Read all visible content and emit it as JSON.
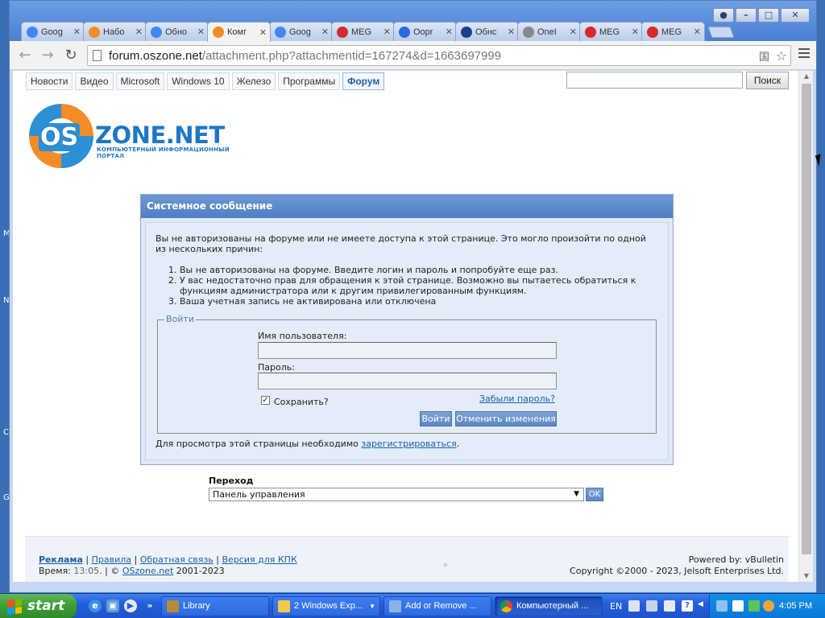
{
  "window": {
    "controls": [
      "user",
      "minimize",
      "maximize",
      "close"
    ]
  },
  "tabs": [
    {
      "label": "Goog",
      "favicon": "chrome-icon",
      "color": "#4285f4"
    },
    {
      "label": "Набо",
      "favicon": "oszone-icon",
      "color": "#f28c28"
    },
    {
      "label": "Обно",
      "favicon": "chrome-icon",
      "color": "#4285f4"
    },
    {
      "label": "Комг",
      "favicon": "oszone-icon",
      "color": "#f28c28",
      "active": true
    },
    {
      "label": "Goog",
      "favicon": "chrome-icon",
      "color": "#4285f4"
    },
    {
      "label": "MEG",
      "favicon": "mega-icon",
      "color": "#d9272e"
    },
    {
      "label": "Oopr",
      "favicon": "arc-icon",
      "color": "#2d6ae0"
    },
    {
      "label": "Обнс",
      "favicon": "ru-icon",
      "color": "#1c3f8a"
    },
    {
      "label": "OneI",
      "favicon": "page-icon",
      "color": "#888888"
    },
    {
      "label": "MEG",
      "favicon": "mega-icon",
      "color": "#d9272e"
    },
    {
      "label": "MEG",
      "favicon": "mega-icon",
      "color": "#d9272e"
    }
  ],
  "address_bar": {
    "host": "forum.oszone.net",
    "path": "/attachment.php?attachmentid=167274&d=1663697999"
  },
  "topnav": {
    "items": [
      "Новости",
      "Видео",
      "Microsoft",
      "Windows 10",
      "Железо",
      "Программы",
      "Форум"
    ],
    "active_index": 6
  },
  "search": {
    "button_label": "Поиск",
    "value": ""
  },
  "logo": {
    "os": "OS",
    "zone": "ZONE.NET",
    "tagline": "КОМПЬЮТЕРНЫЙ ИНФОРМАЦИОННЫЙ ПОРТАЛ"
  },
  "system_message": {
    "title": "Системное сообщение",
    "intro": "Вы не авторизованы на форуме или не имеете доступа к этой странице. Это могло произойти по одной из нескольких причин:",
    "reasons": [
      "Вы не авторизованы на форуме. Введите логин и пароль и попробуйте еще раз.",
      "У вас недостаточно прав для обращения к этой странице. Возможно вы пытаетесь обратиться к функциям администратора или к другим привилегированным функциям.",
      "Ваша учетная запись не активирована или отключена"
    ],
    "login": {
      "legend": "Войти",
      "username_label": "Имя пользователя:",
      "username_value": "",
      "password_label": "Пароль:",
      "password_value": "",
      "remember_label": "Сохранить?",
      "remember_checked": true,
      "forgot_label": "Забыли пароль?",
      "login_button": "Войти",
      "reset_button": "Отменить изменения"
    },
    "register_prefix": "Для просмотра этой страницы необходимо",
    "register_link": "зарегистрироваться",
    "register_suffix": "."
  },
  "jump": {
    "label": "Переход",
    "selected": "Панель управления",
    "ok": "OK"
  },
  "footer": {
    "links": [
      "Реклама",
      "Правила",
      "Обратная связь",
      "Версия для КПК"
    ],
    "time_label": "Время:",
    "time_value": "13:05",
    "copyright_sign": "©",
    "site_link": "OSzone.net",
    "years": "2001-2023",
    "powered": "Powered by: vBulletin",
    "copyright": "Copyright ©2000 - 2023, Jelsoft Enterprises Ltd."
  },
  "taskbar": {
    "start_label": "start",
    "items": [
      {
        "label": "Library",
        "icon": "library-icon",
        "color": "#b58a3a"
      },
      {
        "label": "2 Windows Exp...",
        "icon": "folder-icon",
        "color": "#f2c94c",
        "dropdown": true
      },
      {
        "label": "Add or Remove ...",
        "icon": "programs-icon",
        "color": "#8bb2e8"
      },
      {
        "label": "Компьютерный ...",
        "icon": "chrome-icon",
        "color": "#4285f4",
        "active": true
      }
    ],
    "language": "EN",
    "clock": "4:05 PM"
  },
  "desktop_letters": [
    "M",
    "N",
    "C",
    "G"
  ]
}
